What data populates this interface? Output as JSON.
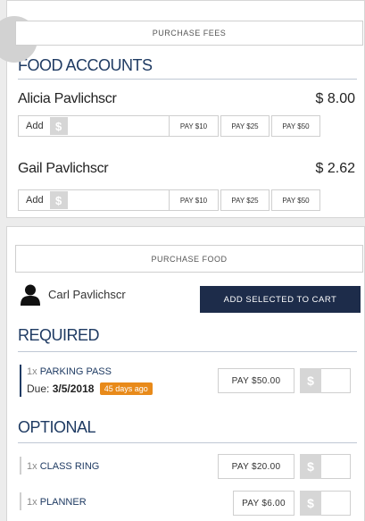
{
  "fees": {
    "header": "PURCHASE FEES",
    "title": "FOOD ACCOUNTS",
    "accounts": [
      {
        "name": "Alicia Pavlichscr",
        "amount": "$ 8.00",
        "add_label": "Add",
        "dollar": "$",
        "pay_buttons": [
          "PAY $10",
          "PAY $25",
          "PAY $50"
        ]
      },
      {
        "name": "Gail Pavlichscr",
        "amount": "$ 2.62",
        "add_label": "Add",
        "dollar": "$",
        "pay_buttons": [
          "PAY $10",
          "PAY $25",
          "PAY $50"
        ]
      }
    ]
  },
  "food": {
    "header": "PURCHASE FOOD",
    "person_name": "Carl Pavlichscr",
    "cart_button": "ADD SELECTED TO CART",
    "required_title": "REQUIRED",
    "optional_title": "OPTIONAL",
    "required_items": [
      {
        "qty": "1x",
        "name": "PARKING PASS",
        "due_label": "Due:",
        "due_date": "3/5/2018",
        "badge": "45 days ago",
        "pay": "PAY $50.00",
        "dollar": "$"
      }
    ],
    "optional_items": [
      {
        "qty": "1x",
        "name": "CLASS RING",
        "pay": "PAY $20.00",
        "dollar": "$"
      },
      {
        "qty": "1x",
        "name": "PLANNER",
        "pay": "PAY $6.00",
        "dollar": "$"
      }
    ]
  },
  "colors": {
    "accent_navy": "#1d2c4a",
    "title_blue": "#1f3b63",
    "badge_orange": "#e88a1a"
  },
  "icons": {
    "person": "person-icon",
    "dollar": "dollar-icon"
  }
}
